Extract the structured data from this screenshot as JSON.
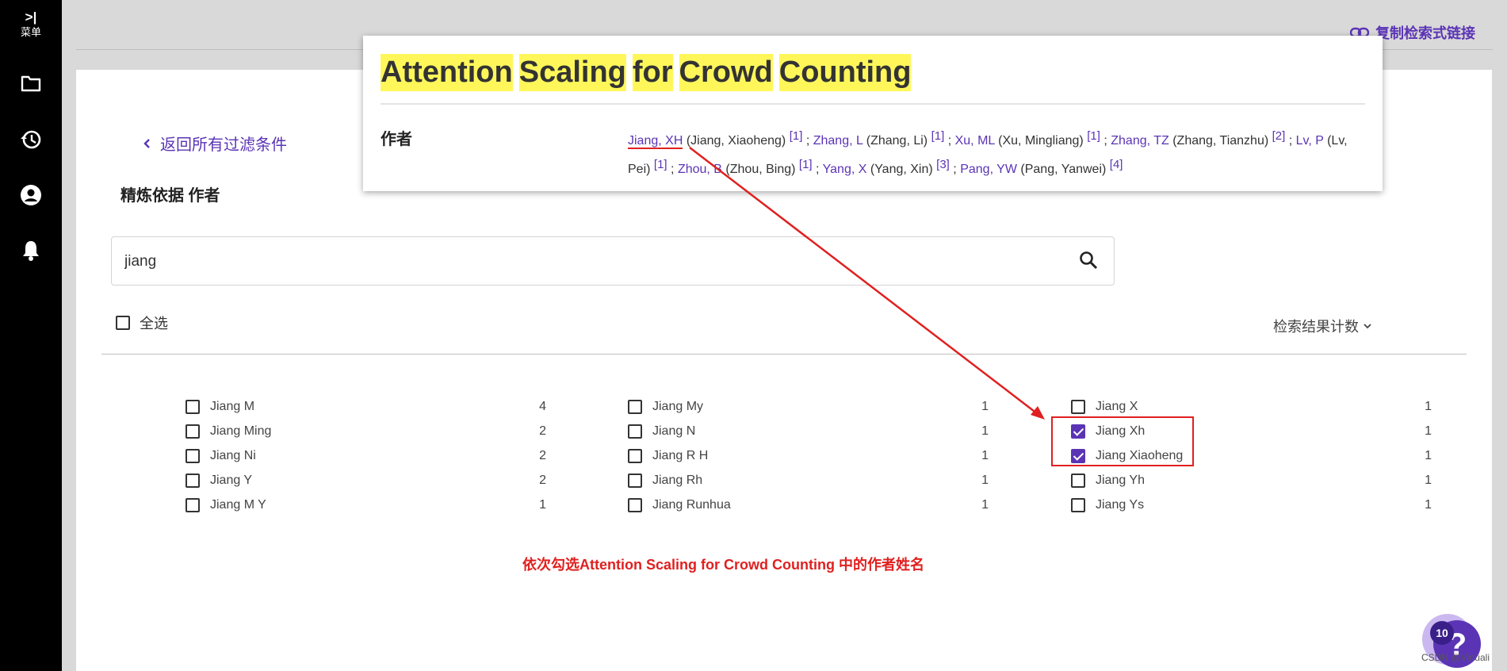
{
  "sidebar": {
    "menu_glyph": ">|",
    "menu_label": "菜单",
    "icons": [
      "folder-icon",
      "history-icon",
      "account-icon",
      "bell-icon"
    ]
  },
  "header": {
    "copy_link_label": "复制检索式链接"
  },
  "refine": {
    "back_label": "返回所有过滤条件",
    "title": "精炼依据 作者",
    "search_value": "jiang",
    "select_all_label": "全选",
    "sort_label": "检索结果计数"
  },
  "results": {
    "columns": [
      [
        {
          "name": "Jiang M",
          "count": "4",
          "checked": false
        },
        {
          "name": "Jiang Ming",
          "count": "2",
          "checked": false
        },
        {
          "name": "Jiang Ni",
          "count": "2",
          "checked": false
        },
        {
          "name": "Jiang Y",
          "count": "2",
          "checked": false
        },
        {
          "name": "Jiang M Y",
          "count": "1",
          "checked": false
        }
      ],
      [
        {
          "name": "Jiang My",
          "count": "1",
          "checked": false
        },
        {
          "name": "Jiang N",
          "count": "1",
          "checked": false
        },
        {
          "name": "Jiang R H",
          "count": "1",
          "checked": false
        },
        {
          "name": "Jiang Rh",
          "count": "1",
          "checked": false
        },
        {
          "name": "Jiang Runhua",
          "count": "1",
          "checked": false
        }
      ],
      [
        {
          "name": "Jiang X",
          "count": "1",
          "checked": false
        },
        {
          "name": "Jiang Xh",
          "count": "1",
          "checked": true
        },
        {
          "name": "Jiang Xiaoheng",
          "count": "1",
          "checked": true
        },
        {
          "name": "Jiang Yh",
          "count": "1",
          "checked": false
        },
        {
          "name": "Jiang Ys",
          "count": "1",
          "checked": false
        }
      ]
    ]
  },
  "popup": {
    "title_words": [
      "Attention",
      "Scaling",
      "for",
      "Crowd",
      "Counting"
    ],
    "author_label": "作者",
    "authors": [
      {
        "abbr": "Jiang, XH",
        "full": "(Jiang, Xiaoheng)",
        "ref": "[1]"
      },
      {
        "abbr": "Zhang, L",
        "full": "(Zhang, Li)",
        "ref": "[1]"
      },
      {
        "abbr": "Xu, ML",
        "full": "(Xu, Mingliang)",
        "ref": "[1]"
      },
      {
        "abbr": "Zhang, TZ",
        "full": "(Zhang, Tianzhu)",
        "ref": "[2]"
      },
      {
        "abbr": "Lv, P",
        "full": "(Lv, Pei)",
        "ref": "[1]"
      },
      {
        "abbr": "Zhou, B",
        "full": "(Zhou, Bing)",
        "ref": "[1]"
      },
      {
        "abbr": "Yang, X",
        "full": "(Yang, Xin)",
        "ref": "[3]"
      },
      {
        "abbr": "Pang, YW",
        "full": "(Pang, Yanwei)",
        "ref": "[4]"
      }
    ]
  },
  "annotation": {
    "caption": "依次勾选Attention Scaling for Crowd Counting 中的作者姓名",
    "color": "#e02020"
  },
  "help": {
    "badge_count": "10",
    "glyph": "?"
  },
  "watermark": "CSDN @Virtuali",
  "colors": {
    "accent": "#5b34b5",
    "highlight": "#fff75a",
    "sidebar": "#000000"
  }
}
